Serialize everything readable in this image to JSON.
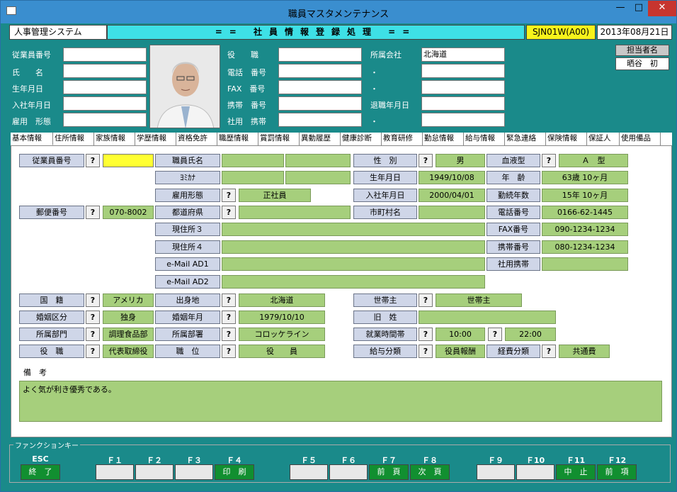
{
  "window": {
    "title": "職員マスタメンテナンス",
    "min": "—",
    "max": "□",
    "close": "✕"
  },
  "header": {
    "system": "人事管理システム",
    "title": "== 社員情報登録処理 ==",
    "program_id": "SJN01W(A00)",
    "date": "2013年08月21日"
  },
  "top": {
    "labels": [
      "従業員番号",
      "氏　　名",
      "生年月日",
      "入社年月日",
      "雇用　形態",
      "役　　職",
      "電話　番号",
      "FAX　番号",
      "携帯　番号",
      "社用　携帯",
      "所属会社",
      "・",
      "・",
      "退職年月日",
      "・"
    ],
    "company_value": "北海道",
    "tanto_label": "担当者名",
    "tanto_value": "晒谷　初"
  },
  "tabs": [
    "基本情報",
    "住所情報",
    "家族情報",
    "学歴情報",
    "資格免許",
    "職歴情報",
    "賞罰情報",
    "異動履歴",
    "健康診断",
    "教育研修",
    "勤怠情報",
    "給与情報",
    "緊急連絡",
    "保険情報",
    "保証人",
    "使用備品"
  ],
  "form": {
    "q": "?",
    "l_jugyoin": "従業員番号",
    "l_shimei": "職員氏名",
    "l_yomi": "ﾖﾐｶﾅ",
    "l_koyo": "雇用形態",
    "v_koyo": "正社員",
    "l_yubin": "郵便番号",
    "v_yubin": "070-8002",
    "l_todofuken": "都道府県",
    "l_genjusho3": "現住所３",
    "l_genjusho4": "現住所４",
    "l_mail1": "e-Mail AD1",
    "l_mail2": "e-Mail AD2",
    "l_seibetsu": "性　別",
    "v_seibetsu": "男",
    "l_ketsueki": "血液型",
    "v_ketsueki": "Ａ　型",
    "l_seinen": "生年月日",
    "v_seinen": "1949/10/08",
    "l_nenrei": "年　齢",
    "v_nenrei": "63歳 10ヶ月",
    "l_nyusha": "入社年月日",
    "v_nyusha": "2000/04/01",
    "l_kinzoku": "勤続年数",
    "v_kinzoku": "15年 10ヶ月",
    "l_shichoson": "市町村名",
    "l_denwa": "電話番号",
    "v_denwa": "0166-62-1445",
    "l_fax": "FAX番号",
    "v_fax": "090-1234-1234",
    "l_keitai": "携帯番号",
    "v_keitai": "080-1234-1234",
    "l_shayo": "社用携帯",
    "l_kokuseki": "国　籍",
    "v_kokuseki": "アメリカ",
    "l_shusshin": "出身地",
    "v_shusshin": "北海道",
    "l_setainushi": "世帯主",
    "v_setainushi": "世帯主",
    "l_kon_kubun": "婚姻区分",
    "v_kon_kubun": "独身",
    "l_kon_nengetsu": "婚姻年月",
    "v_kon_nengetsu": "1979/10/10",
    "l_kyusei": "旧　姓",
    "l_bumon": "所属部門",
    "v_bumon": "調理食品部",
    "l_busho": "所属部署",
    "v_busho": "コロッケライン",
    "l_shugyo": "就業時間帯",
    "v_shugyo_from": "10:00",
    "v_shugyo_to": "22:00",
    "l_yakushoku": "役　職",
    "v_yakushoku": "代表取締役",
    "l_shokui": "職　位",
    "v_shokui": "役　　員",
    "l_kyuyo": "給与分類",
    "v_kyuyo": "役員報酬",
    "l_keihi": "経費分類",
    "v_keihi": "共通費",
    "l_biko": "備　考",
    "v_biko": "よく気が利き優秀である。"
  },
  "fkeys": {
    "caption": "ファンクションキー",
    "items": [
      {
        "key": "ESC",
        "label": "終　了",
        "enabled": true
      },
      {
        "key": "Ｆ１",
        "label": "",
        "enabled": false
      },
      {
        "key": "Ｆ２",
        "label": "",
        "enabled": false
      },
      {
        "key": "Ｆ３",
        "label": "",
        "enabled": false
      },
      {
        "key": "Ｆ４",
        "label": "印　刷",
        "enabled": true
      },
      {
        "key": "Ｆ５",
        "label": "",
        "enabled": false
      },
      {
        "key": "Ｆ６",
        "label": "",
        "enabled": false
      },
      {
        "key": "Ｆ７",
        "label": "前　頁",
        "enabled": true
      },
      {
        "key": "Ｆ８",
        "label": "次　頁",
        "enabled": true
      },
      {
        "key": "Ｆ９",
        "label": "",
        "enabled": false
      },
      {
        "key": "Ｆ10",
        "label": "",
        "enabled": false
      },
      {
        "key": "Ｆ11",
        "label": "中　止",
        "enabled": true
      },
      {
        "key": "Ｆ12",
        "label": "前　項",
        "enabled": true
      }
    ]
  },
  "colors": {
    "frame": "#1a8a8a",
    "label": "#cfd6e8",
    "value": "#a6cf7c",
    "title": "#3ee0e6",
    "fkey_on": "#118f30"
  }
}
